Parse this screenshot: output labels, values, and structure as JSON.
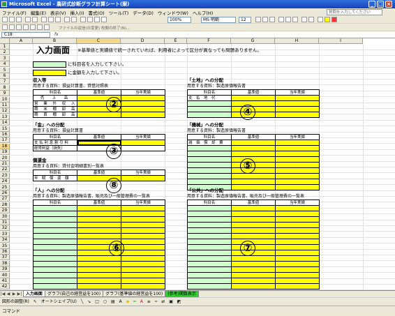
{
  "window": {
    "title": "Microsoft Excel - 農研式診断グラフ計算シート(案)"
  },
  "menu": [
    "ファイル(F)",
    "編集(E)",
    "表示(V)",
    "挿入(I)",
    "書式(O)",
    "ツール(T)",
    "データ(D)",
    "ウィンドウ(W)",
    "ヘルプ(H)"
  ],
  "help_placeholder": "質問を入力してください",
  "toolbar": {
    "zoom": "100%",
    "font": "MS 明朝",
    "size": "12",
    "review_text": "ファイルの返信(の変更) 校閲の終了(N)..."
  },
  "formula": {
    "namebox": "C18",
    "fx": "fx"
  },
  "columns": [
    "A",
    "B",
    "C",
    "D",
    "E",
    "F",
    "G",
    "H",
    "I"
  ],
  "rows": [
    "1",
    "2",
    "3",
    "4",
    "5",
    "6",
    "7",
    "8",
    "9",
    "10",
    "11",
    "12",
    "13",
    "14",
    "15",
    "16",
    "17",
    "18",
    "19",
    "20",
    "21",
    "22",
    "23",
    "24",
    "25",
    "26",
    "27",
    "28",
    "29",
    "30",
    "31",
    "32",
    "33",
    "34",
    "35",
    "36",
    "37",
    "38",
    "39",
    "40",
    "41",
    "42"
  ],
  "sheet": {
    "title": "入力画面",
    "note": "※基準値と実績値で統一されていれば、利用者によって区分が異なっても問題ありません。",
    "legend_green": "に科目名を入力して下さい。",
    "legend_yellow": "に金額を入力して下さい。",
    "headers": {
      "kamoku": "科目名",
      "kijun": "基準値",
      "jisseki": "当年実績"
    },
    "s1": {
      "title": "収入等",
      "src": "用意する資料：損益計算書、貸借対照表",
      "rows": [
        "売　上　高",
        "営 業 外 収 入",
        "期 末 棚 卸 高",
        "期 首 棚 卸 高"
      ],
      "num": "②"
    },
    "s2": {
      "title": "「土地」への分配",
      "src": "用意する資料：製造原価報告書",
      "rows": [
        "支　払　地　代"
      ],
      "num": "④"
    },
    "s3": {
      "title": "「金」への分配",
      "src": "用意する資料：損益計算書",
      "rows": [
        "支 払 利 息 割 引 料",
        "経常利益（損失）"
      ],
      "num": "③"
    },
    "s4": {
      "title": "「機械」への分配",
      "src": "用意する資料：製造原価報告書",
      "rows": [
        "減　価　償　却　費"
      ],
      "num": "⑤"
    },
    "s5": {
      "title": "償還金",
      "src": "用意する資料：貸付金明細書別一覧表",
      "rows": [
        "年　賦　償　還　額"
      ],
      "num": "⑧"
    },
    "s6": {
      "title": "「人」への分配",
      "src": "用意する資料：製造原価報告書、販売及び一般管理費の一覧表",
      "num": "⑥"
    },
    "s7": {
      "title": "「公共」への分配",
      "src": "用意する資料：製造原価報告書、販売及び一般管理費の一覧表",
      "num": "⑦"
    }
  },
  "sheet_tabs": [
    "入力画面",
    "グラフ(自己の経営益を100)",
    "グラフ(基準値の経営益を100)",
    "(参考)関数表示"
  ],
  "drawing": {
    "label": "図形の調整(R)",
    "autoshape": "オートシェイプ(U)"
  },
  "status": "コマンド"
}
